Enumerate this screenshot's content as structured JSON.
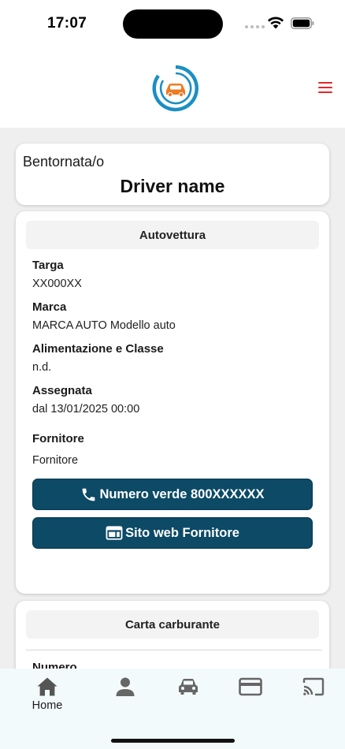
{
  "status_bar": {
    "time": "17:07"
  },
  "header": {
    "logo_icon": "car-charging-logo-icon",
    "menu_icon": "hamburger-menu-icon",
    "accent_color": "#e8262a",
    "brand_color": "#1b8fc4"
  },
  "welcome": {
    "greeting": "Bentornata/o",
    "name": "Driver name"
  },
  "vehicle": {
    "title": "Autovettura",
    "fields": [
      {
        "label": "Targa",
        "value": "XX000XX"
      },
      {
        "label": "Marca",
        "value": "MARCA AUTO Modello auto"
      },
      {
        "label": "Alimentazione e Classe",
        "value": "n.d."
      },
      {
        "label": "Assegnata",
        "value": "dal 13/01/2025 00:00"
      }
    ],
    "supplier_label": "Fornitore",
    "supplier_value": "Fornitore",
    "phone_button": "Numero verde 800XXXXXX",
    "website_button": "Sito web Fornitore",
    "button_color": "#0c4a66"
  },
  "fuel_card": {
    "title": "Carta carburante",
    "first_label": "Numero"
  },
  "tabs": [
    {
      "icon": "home-icon",
      "label": "Home"
    },
    {
      "icon": "person-icon",
      "label": ""
    },
    {
      "icon": "car-icon",
      "label": ""
    },
    {
      "icon": "credit-card-icon",
      "label": ""
    },
    {
      "icon": "cast-icon",
      "label": ""
    }
  ]
}
